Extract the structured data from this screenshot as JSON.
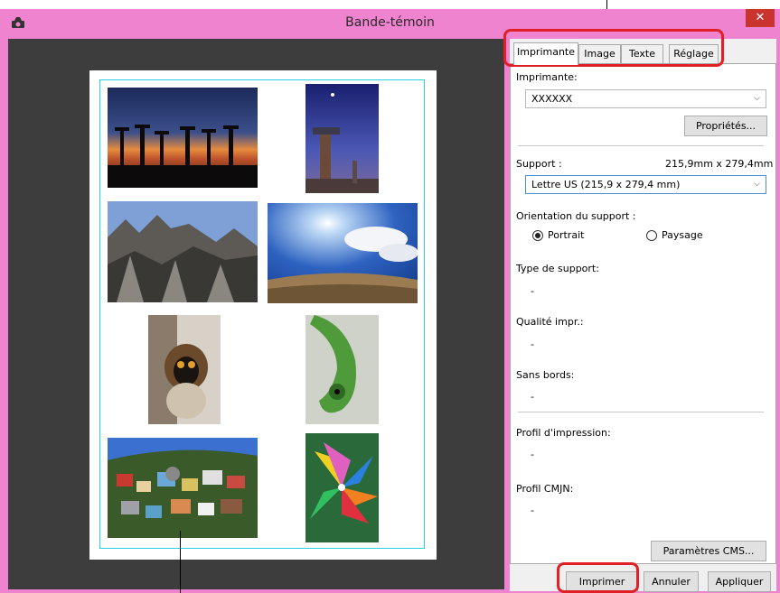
{
  "window": {
    "title": "Bande-témoin",
    "close_glyph": "✕"
  },
  "tabs": [
    {
      "label": "Imprimante",
      "active": true
    },
    {
      "label": "Image",
      "active": false
    },
    {
      "label": "Texte",
      "active": false
    },
    {
      "label": "Réglage",
      "active": false
    }
  ],
  "printer": {
    "label": "Imprimante:",
    "selected": "XXXXXX",
    "properties_button": "Propriétés..."
  },
  "media": {
    "label": "Support :",
    "size_readout": "215,9mm x 279,4mm",
    "selected": "Lettre US (215,9 x 279,4 mm)"
  },
  "orientation": {
    "label": "Orientation du support :",
    "portrait": "Portrait",
    "landscape": "Paysage",
    "selected": "portrait"
  },
  "media_type": {
    "label": "Type de support:",
    "value": "-"
  },
  "print_quality": {
    "label": "Qualité impr.:",
    "value": "-"
  },
  "borderless": {
    "label": "Sans bords:",
    "value": "-"
  },
  "print_profile": {
    "label": "Profil d'impression:",
    "value": "-"
  },
  "cmyk_profile": {
    "label": "Profil CMJN:",
    "value": "-"
  },
  "cms_button": "Paramètres CMS...",
  "footer": {
    "print_button": "Imprimer",
    "cancel_button": "Annuler",
    "apply_button": "Appliquer"
  },
  "colors": {
    "titlebar": "#ef83d0",
    "callout": "#e11f26",
    "print_area_border": "#28d2de",
    "preview_background": "#3d3d3d"
  },
  "thumbnails": [
    {
      "name": "baobabs-sunset-photo"
    },
    {
      "name": "baobab-night-photo"
    },
    {
      "name": "tsingy-rocks-photo"
    },
    {
      "name": "sun-sky-fisheye-photo"
    },
    {
      "name": "lemur-photo"
    },
    {
      "name": "chameleon-photo"
    },
    {
      "name": "town-hillside-photo"
    },
    {
      "name": "pinwheels-photo"
    }
  ]
}
